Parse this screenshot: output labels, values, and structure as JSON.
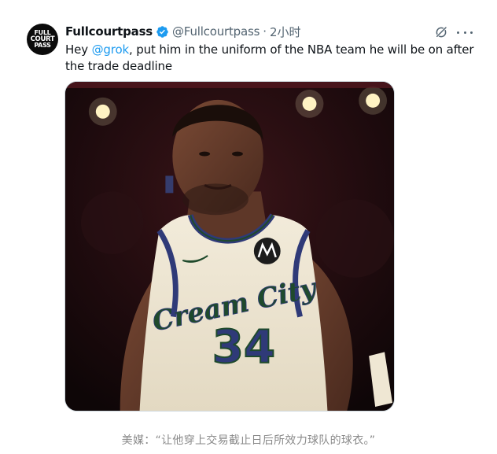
{
  "post": {
    "author": {
      "display_name": "Fullcourtpass",
      "handle": "@Fullcourtpass",
      "timestamp": "2小时",
      "avatar_text": [
        "FULL",
        "COURT",
        "PASS"
      ]
    },
    "separator": "·",
    "text": {
      "prefix": "Hey ",
      "mention": "@grok",
      "suffix": ", put him in the uniform of the NBA team he will be on after the trade deadline"
    },
    "icons": {
      "verified": "verified-badge-icon",
      "grok": "grok-icon",
      "more": "more-options-icon"
    },
    "media": {
      "jersey_text": "Cream City",
      "jersey_number": "34"
    }
  },
  "caption": "美媒：“让他穿上交易截止日后所效力球队的球衣。”",
  "colors": {
    "link": "#1d9bf0",
    "muted": "#536471",
    "verified": "#1d9bf0",
    "jersey": "#efe7d3",
    "jersey_trim": "#2f3a78",
    "jersey_green": "#1f4a2c"
  }
}
